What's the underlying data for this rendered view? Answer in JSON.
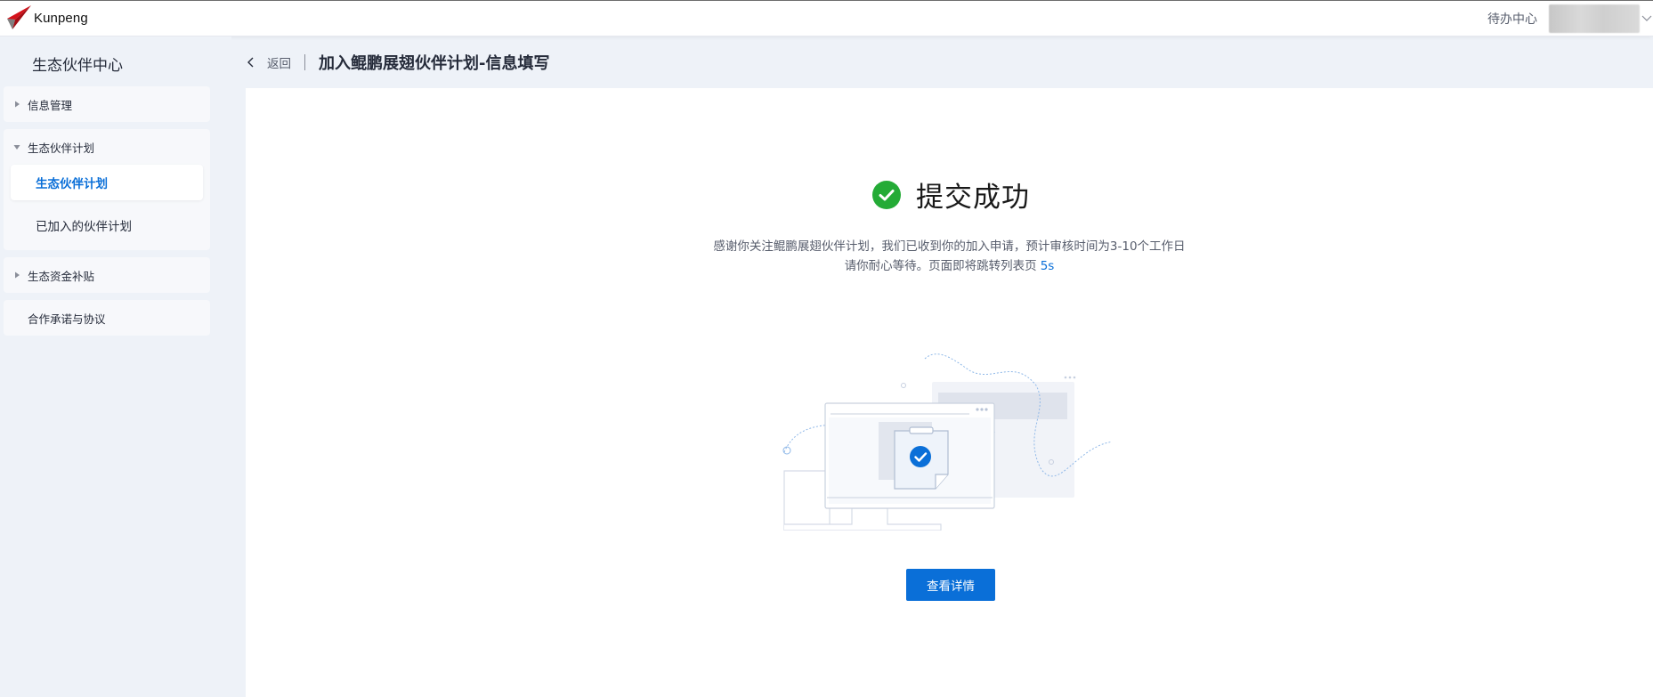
{
  "header": {
    "brand": "Kunpeng",
    "todo_label": "待办中心",
    "logo_color": "#c7000b"
  },
  "sidebar": {
    "title": "生态伙伴中心",
    "groups": [
      {
        "label": "信息管理",
        "expanded": false
      },
      {
        "label": "生态伙伴计划",
        "expanded": true,
        "children": [
          {
            "label": "生态伙伴计划",
            "active": true
          },
          {
            "label": "已加入的伙伴计划",
            "active": false
          }
        ]
      },
      {
        "label": "生态资金补贴",
        "expanded": false
      },
      {
        "label": "合作承诺与协议",
        "expanded": false
      }
    ]
  },
  "breadcrumb": {
    "back_label": "返回",
    "page_title": "加入鲲鹏展翅伙伴计划-信息填写"
  },
  "result": {
    "title": "提交成功",
    "line1": "感谢你关注鲲鹏展翅伙伴计划，我们已收到你的加入申请，预计审核时间为3-10个工作日",
    "line2": "请你耐心等待。页面即将跳转列表页",
    "countdown": "5s",
    "button_label": "查看详情",
    "success_color": "#24ab36",
    "accent_color": "#0a6fd8"
  }
}
